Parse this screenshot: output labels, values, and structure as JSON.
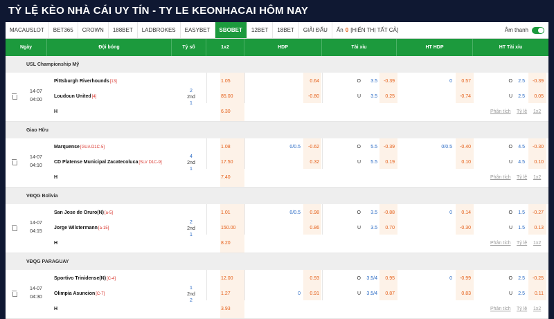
{
  "title": "TỶ LỆ KÈO NHÀ CÁI UY TÍN - TY LE KEONHACAI HÔM NAY",
  "tabs": [
    "MACAUSLOT",
    "BET365",
    "CROWN",
    "188BET",
    "LADBROKES",
    "EASYBET",
    "SBOBET",
    "12BET",
    "18BET",
    "GIẢI ĐẤU"
  ],
  "active_tab": "SBOBET",
  "filter": {
    "prefix": "Ẩn",
    "count": "0",
    "show_all": "[HIỂN THỊ TẤT CẢ]"
  },
  "sound_label": "Âm thanh",
  "columns": [
    "Ngày",
    "Đội bóng",
    "Tỷ số",
    "1x2",
    "HDP",
    "Tài xỉu",
    "HT HDP",
    "HT Tài xỉu"
  ],
  "links": {
    "analysis": "Phân tích",
    "odds": "Tỷ lệ",
    "x12": "1x2"
  },
  "ou_labels": {
    "over": "O",
    "under": "U"
  },
  "matches": [
    {
      "league": "USL Championship Mỹ",
      "date": "14-07",
      "time": "04:00",
      "home": "Pittsburgh Riverhounds",
      "home_rank": "[13]",
      "away": "Loudoun United",
      "away_rank": "[4]",
      "score": [
        "2",
        "2nd",
        "1"
      ],
      "x12": [
        "1.05",
        "85.00",
        "6.30"
      ],
      "hdp": {
        "home_line": "",
        "home_odd": "0.64",
        "away_line": "",
        "away_odd": "-0.80"
      },
      "ou": {
        "over_line": "3.5",
        "over_odd": "-0.39",
        "under_line": "3.5",
        "under_odd": "0.25"
      },
      "ht_hdp": {
        "home_line": "0",
        "home_odd": "0.57",
        "away_line": "",
        "away_odd": "-0.74"
      },
      "ht_ou": {
        "over_line": "2.5",
        "over_odd": "-0.39",
        "under_line": "2.5",
        "under_odd": "0.05"
      },
      "draw": "H"
    },
    {
      "league": "Giao Hữu",
      "date": "14-07",
      "time": "04:10",
      "home": "Marquense",
      "home_rank": "[GUA D1C-5]",
      "away": "CD Platense Municipal Zacatecoluca",
      "away_rank": "[SLV D1C-9]",
      "score": [
        "4",
        "2nd",
        "1"
      ],
      "x12": [
        "1.08",
        "17.50",
        "7.40"
      ],
      "hdp": {
        "home_line": "0/0.5",
        "home_odd": "-0.62",
        "away_line": "",
        "away_odd": "0.32"
      },
      "ou": {
        "over_line": "5.5",
        "over_odd": "-0.39",
        "under_line": "5.5",
        "under_odd": "0.19"
      },
      "ht_hdp": {
        "home_line": "0/0.5",
        "home_odd": "-0.40",
        "away_line": "",
        "away_odd": "0.10"
      },
      "ht_ou": {
        "over_line": "4.5",
        "over_odd": "-0.30",
        "under_line": "4.5",
        "under_odd": "0.10"
      },
      "draw": "H"
    },
    {
      "league": "VĐQG Bolivia",
      "date": "14-07",
      "time": "04:15",
      "home": "San Jose de Oruro(N)",
      "home_rank": "[a-5]",
      "away": "Jorge Wilstermann",
      "away_rank": "[a-15]",
      "score": [
        "2",
        "2nd",
        "1"
      ],
      "x12": [
        "1.01",
        "150.00",
        "8.20"
      ],
      "hdp": {
        "home_line": "0/0.5",
        "home_odd": "0.98",
        "away_line": "",
        "away_odd": "0.86"
      },
      "ou": {
        "over_line": "3.5",
        "over_odd": "-0.88",
        "under_line": "3.5",
        "under_odd": "0.70"
      },
      "ht_hdp": {
        "home_line": "0",
        "home_odd": "0.14",
        "away_line": "",
        "away_odd": "-0.30"
      },
      "ht_ou": {
        "over_line": "1.5",
        "over_odd": "-0.27",
        "under_line": "1.5",
        "under_odd": "0.13"
      },
      "draw": "H"
    },
    {
      "league": "VĐQG PARAGUAY",
      "date": "14-07",
      "time": "04:30",
      "home": "Sportivo Trinidense(N)",
      "home_rank": "[C-4]",
      "away": "Olimpia Asuncion",
      "away_rank": "[C-7]",
      "score": [
        "1",
        "2nd",
        "2"
      ],
      "x12": [
        "12.00",
        "1.27",
        "3.93"
      ],
      "hdp": {
        "home_line": "",
        "home_odd": "0.93",
        "away_line": "0",
        "away_odd": "0.91"
      },
      "ou": {
        "over_line": "3.5/4",
        "over_odd": "0.95",
        "under_line": "3.5/4",
        "under_odd": "0.87"
      },
      "ht_hdp": {
        "home_line": "0",
        "home_odd": "-0.99",
        "away_line": "",
        "away_odd": "0.83"
      },
      "ht_ou": {
        "over_line": "2.5",
        "over_odd": "-0.25",
        "under_line": "2.5",
        "under_odd": "0.11"
      },
      "draw": "H"
    }
  ]
}
